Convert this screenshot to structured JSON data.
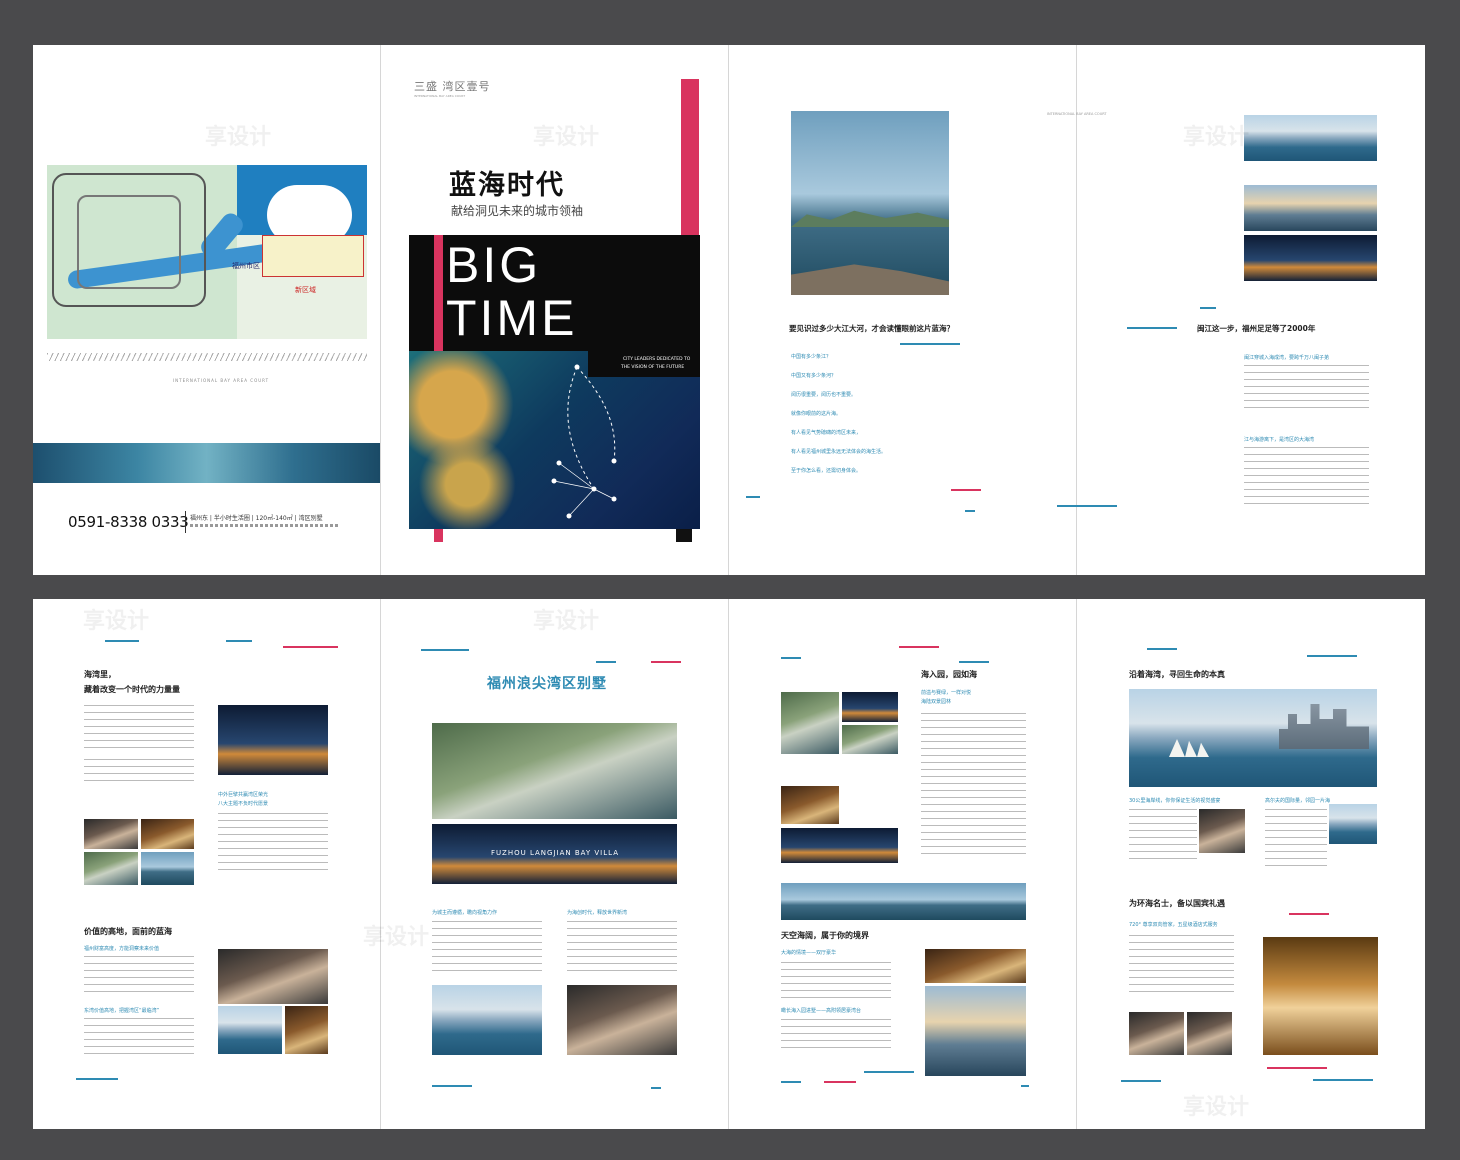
{
  "watermark": "享设计",
  "top_spread": {
    "back_cover": {
      "phone": "0591-8338 0333",
      "info_line": "福州东 | 半小时生活圈 | 120㎡-140㎡ | 湾区别墅",
      "small_caption": "INTERNATIONAL BAY AREA COURT",
      "map_labels": {
        "fuzhou": "福州市区",
        "new_area": "新区域"
      }
    },
    "cover": {
      "brand": "三盛 湾区壹号",
      "brand_sub": "INTERNATIONAL BAY AREA COURT",
      "title_cn": "蓝海时代",
      "subtitle_cn": "献给洞见未来的城市领袖",
      "big": "BIG",
      "time": "TIME",
      "tagline_1": "CITY LEADERS DEDICATED TO",
      "tagline_2": "THE VISION OF THE FUTURE"
    },
    "page3": {
      "headline": "要见识过多少大江大河，才会读懂眼前这片蓝海？",
      "lines": [
        "中国有多少条江？",
        "中国又有多少条河？",
        "阅历很重要，阅历也不重要。",
        "就像你眼前的这片海。",
        "有人看见气势磅礴的湾区未来，",
        "有人看见福州城里永远无法体会的海生活。",
        "至于你怎么看，还需切身体会。"
      ]
    },
    "page4": {
      "small_caption": "INTERNATIONAL BAY AREA COURT",
      "headline": "闽江这一步，福州足足等了2000年",
      "sub1": "闽江穿城入海成湾，要跨千万八闽子弟",
      "sub2": "江与海游离下，是湾区的大海湾"
    }
  },
  "bottom_spread": {
    "page5": {
      "title1": "海湾里，",
      "title2": "藏着改变一个时代的力量量",
      "sub_a": "中外巨擘共赢湾区荣光",
      "sub_b": "八大主题不负时代愿景",
      "title3": "价值的高地，面前的蓝海",
      "sub_c": "福州财富高度，方能洞察未来价值",
      "sub_d": "东湾价值高地，把握湾区“最临湾”"
    },
    "page6": {
      "title": "福州浪尖湾区别墅",
      "banner_en": "FUZHOU LANGJIAN BAY VILLA",
      "sub_left": "为城主而遵循，瞻向视角力作",
      "sub_right": "为海创时代，释放世界新湾"
    },
    "page7": {
      "title1": "海入园，园如海",
      "sub1": "前溢与赛绿，一样对悦",
      "sub1b": "海陆双景园林",
      "title2": "天空海阔，属于你的境界",
      "sub2": "大海的情境——双厅豪华",
      "sub3": "瞰长海入园进墅——高附领居豪湾台"
    },
    "page8": {
      "title1": "沿着海湾，寻回生命的本真",
      "sub1": "30公里海岸线，你你保证生活的视觉盛宴",
      "sub2": "高尔夫的国际量，邻园一片海",
      "title2": "为环海名士，备以国宾礼遇",
      "sub3": "720° 尊享双向管家，五星级酒店式服务"
    }
  }
}
